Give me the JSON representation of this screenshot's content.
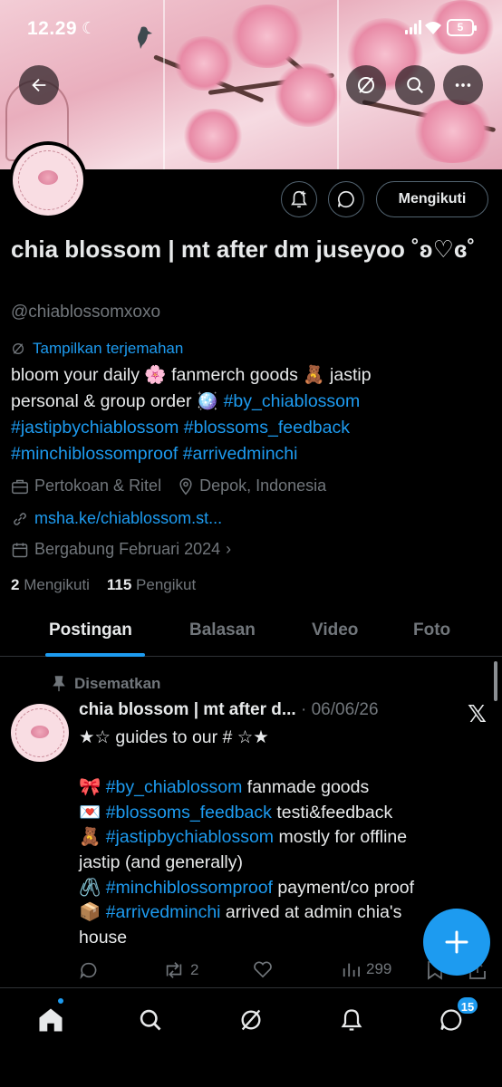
{
  "status_bar": {
    "time": "12.29",
    "battery": "5"
  },
  "profile": {
    "name": "chia blossom | mt after dm juseyoo ˚ʚ♡ɞ˚",
    "handle": "@chiablossomxoxo",
    "follow_button": "Mengikuti",
    "translate_label": "Tampilkan terjemahan",
    "bio": [
      [
        {
          "t": "bloom your daily 🌸 fanmerch goods 🧸 jastip"
        }
      ],
      [
        {
          "t": "personal & group order 🪩 "
        },
        {
          "t": "#by_chiablossom",
          "tag": true
        }
      ],
      [
        {
          "t": "#jastipbychiablossom",
          "tag": true
        },
        {
          "t": " "
        },
        {
          "t": "#blossoms_feedback",
          "tag": true
        }
      ],
      [
        {
          "t": "#minchiblossomproof",
          "tag": true
        },
        {
          "t": " "
        },
        {
          "t": "#arrivedminchi",
          "tag": true
        }
      ]
    ],
    "category": "Pertokoan & Ritel",
    "location": "Depok, Indonesia",
    "link": "msha.ke/chiablossom.st...",
    "joined": "Bergabung Februari 2024",
    "following_count": "2",
    "following_label": "Mengikuti",
    "followers_count": "115",
    "followers_label": "Pengikut"
  },
  "tabs": [
    {
      "label": "Postingan",
      "active": true
    },
    {
      "label": "Balasan",
      "active": false
    },
    {
      "label": "Video",
      "active": false
    },
    {
      "label": "Foto",
      "active": false
    }
  ],
  "pinned_post": {
    "pinned_label": "Disematkan",
    "author": "chia blossom | mt after d...",
    "date": "· 06/06/26",
    "lines": [
      [
        {
          "t": "★☆  guides to our #  ☆★"
        }
      ],
      [
        {
          "t": ""
        }
      ],
      [
        {
          "t": "🎀 "
        },
        {
          "t": "#by_chiablossom",
          "tag": true
        },
        {
          "t": " fanmade goods"
        }
      ],
      [
        {
          "t": "💌 "
        },
        {
          "t": "#blossoms_feedback",
          "tag": true
        },
        {
          "t": " testi&feedback"
        }
      ],
      [
        {
          "t": "🧸 "
        },
        {
          "t": "#jastipbychiablossom",
          "tag": true
        },
        {
          "t": " mostly for offline"
        }
      ],
      [
        {
          "t": "jastip (and generally)"
        }
      ],
      [
        {
          "t": "🖇️ "
        },
        {
          "t": "#minchiblossomproof",
          "tag": true
        },
        {
          "t": " payment/co proof"
        }
      ],
      [
        {
          "t": "📦  "
        },
        {
          "t": "#arrivedminchi",
          "tag": true
        },
        {
          "t": " arrived at admin chia's"
        }
      ],
      [
        {
          "t": "house"
        }
      ]
    ],
    "retweets": "2",
    "views": "299"
  },
  "nav": {
    "messages_badge": "15"
  },
  "colors": {
    "accent": "#1d9bf0",
    "text": "#e7e9ea",
    "muted": "#71767b",
    "border": "#2f3336"
  }
}
